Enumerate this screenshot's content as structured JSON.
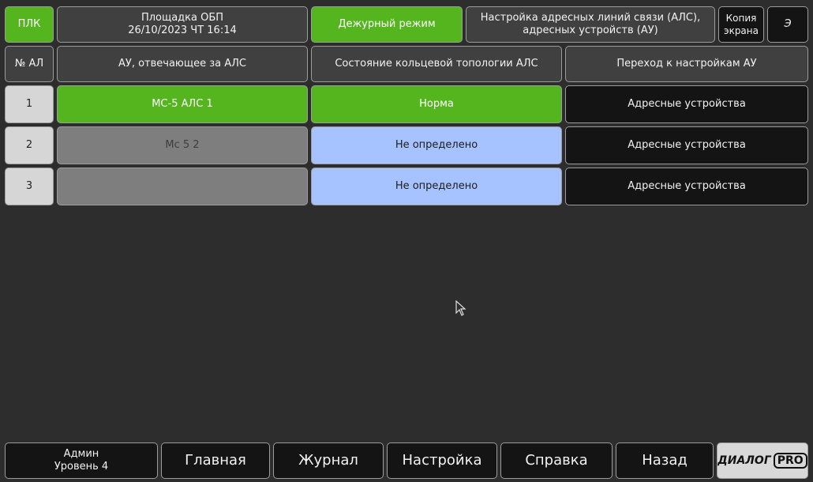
{
  "header": {
    "plk": "ПЛК",
    "site_line1": "Площадка ОБП",
    "site_line2": "26/10/2023 ЧТ 16:14",
    "mode": "Дежурный режим",
    "title_line1": "Настройка адресных линий связи (АЛС),",
    "title_line2": "адресных устройств (АУ)",
    "copy_line1": "Копия",
    "copy_line2": "экрана",
    "extra": "Э"
  },
  "columns": {
    "num": "№ АЛ",
    "device": "АУ, отвечающее за АЛС",
    "state": "Состояние кольцевой топологии АЛС",
    "goto": "Переход к настройкам АУ"
  },
  "rows": [
    {
      "num": "1",
      "device": "МС-5 АЛС 1",
      "state": "Норма",
      "goto": "Адресные устройства"
    },
    {
      "num": "2",
      "device": "Мс 5 2",
      "state": "Не определено",
      "goto": "Адресные устройства"
    },
    {
      "num": "3",
      "device": "",
      "state": "Не определено",
      "goto": "Адресные устройства"
    }
  ],
  "footer": {
    "user_line1": "Админ",
    "user_line2": "Уровень 4",
    "main": "Главная",
    "journal": "Журнал",
    "settings": "Настройка",
    "help": "Справка",
    "back": "Назад",
    "logo_left": "ДИАЛОГ",
    "logo_right": "PRO"
  },
  "colors": {
    "background": "#2d2d2d",
    "status_ok": "#55b51e",
    "status_unknown": "#a6c2ff",
    "device_inactive": "#7e7e7e"
  }
}
